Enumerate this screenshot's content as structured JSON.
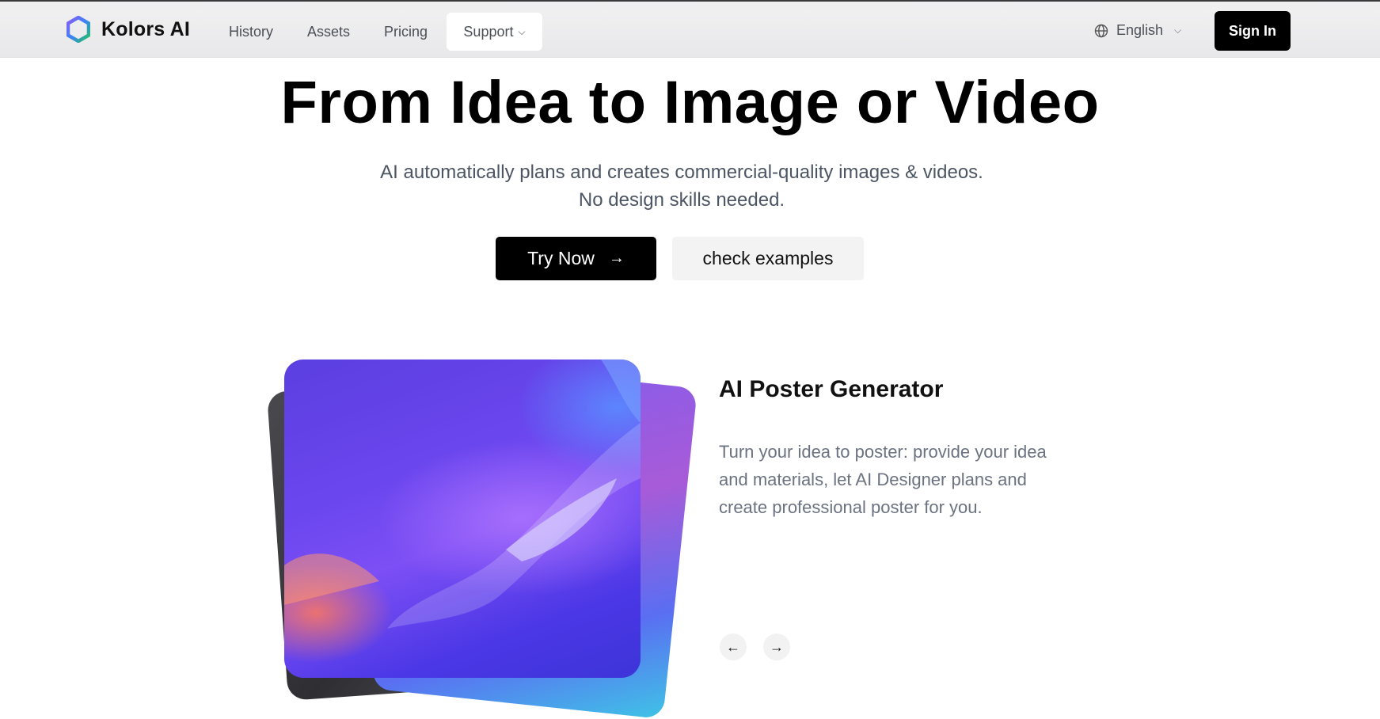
{
  "brand": {
    "name": "Kolors AI",
    "logo_icon": "hexagon-logo-icon"
  },
  "nav": {
    "history": "History",
    "assets": "Assets",
    "pricing": "Pricing",
    "support": "Support",
    "support_chevron": "⌵",
    "language": "English",
    "language_chevron": "⌵",
    "signin": "Sign In"
  },
  "hero": {
    "title": "From Idea to Image or Video",
    "subtitle": "AI automatically plans and creates commercial-quality images & videos. No design skills needed.",
    "try_label": "Try Now",
    "try_arrow": "→",
    "examples_label": "check examples"
  },
  "feature": {
    "title": "AI Poster Generator",
    "description": "Turn your idea to poster: provide your idea and materials, let AI Designer plans and create professional poster for you.",
    "prev_arrow": "←",
    "next_arrow": "→"
  },
  "colors": {
    "primary_button": "#000000",
    "secondary_button": "#f3f3f4",
    "body_text": "#4b5563",
    "accent_purple": "#6a46ee"
  }
}
